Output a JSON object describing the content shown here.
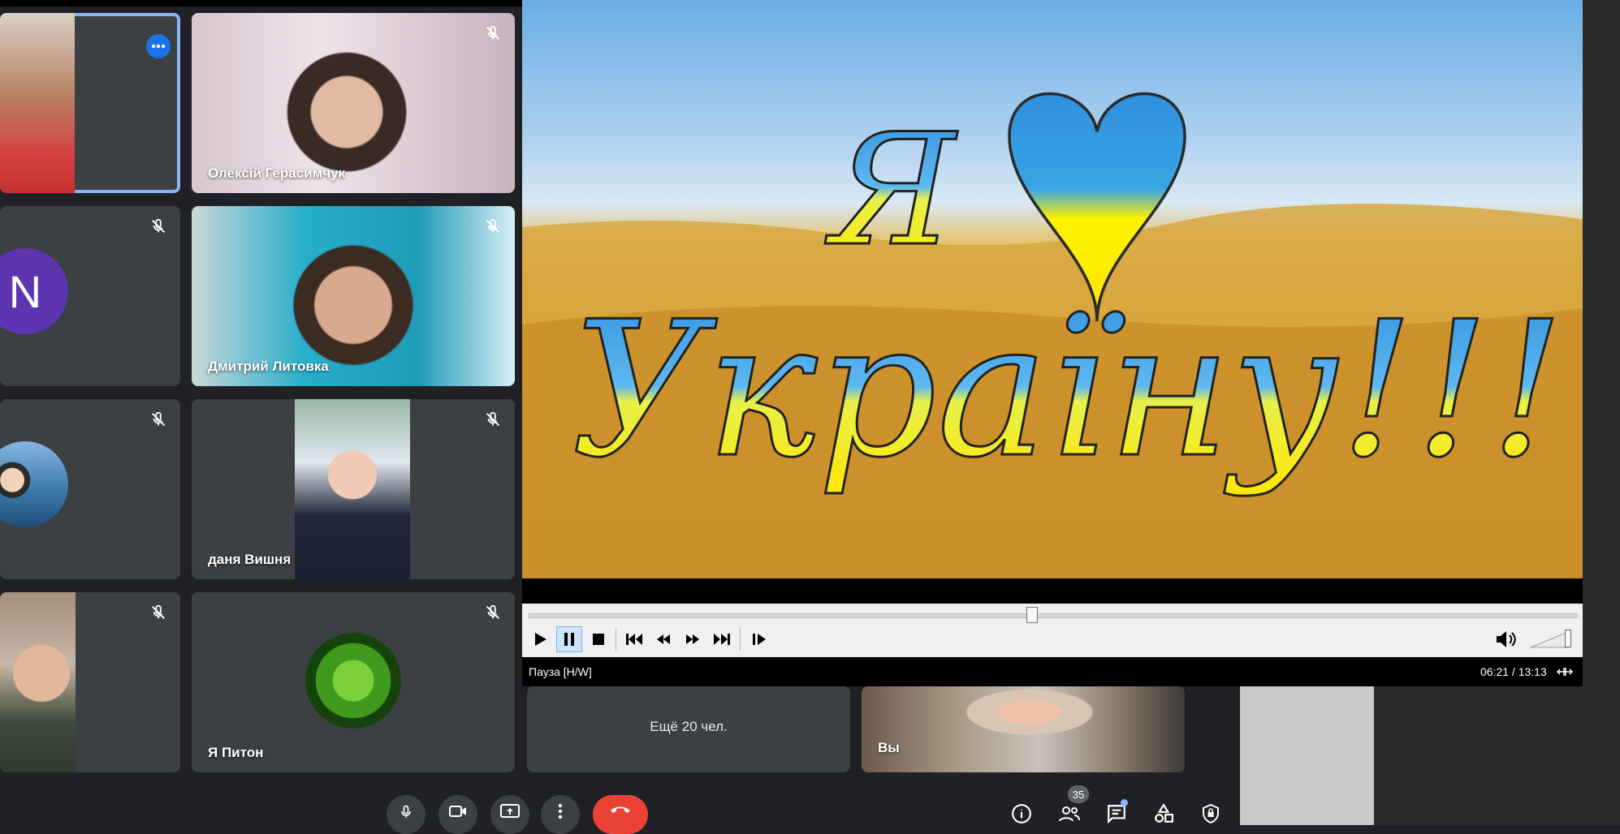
{
  "participants": [
    {
      "name": ""
    },
    {
      "name": "Олексій Герасимчук"
    },
    {
      "name": "",
      "initial": "N"
    },
    {
      "name": "Дмитрий Литовка"
    },
    {
      "name": ""
    },
    {
      "name": "даня Вишня"
    },
    {
      "name": ""
    },
    {
      "name": "Я Питон"
    }
  ],
  "more_people": "Ещё 20 чел.",
  "self_label": "Вы",
  "people_count": "35",
  "player": {
    "status_left": "Пауза [H/W]",
    "time": "06:21 / 13:13",
    "progress": 0.48,
    "volume": 1.0
  },
  "video_text": {
    "line1": "Я",
    "line2": "Україну!!!"
  },
  "colors": {
    "end_call": "#ea4335",
    "accent": "#1a73e8",
    "ukraine_blue": "#2f8fdc",
    "ukraine_yellow": "#ffe600"
  }
}
